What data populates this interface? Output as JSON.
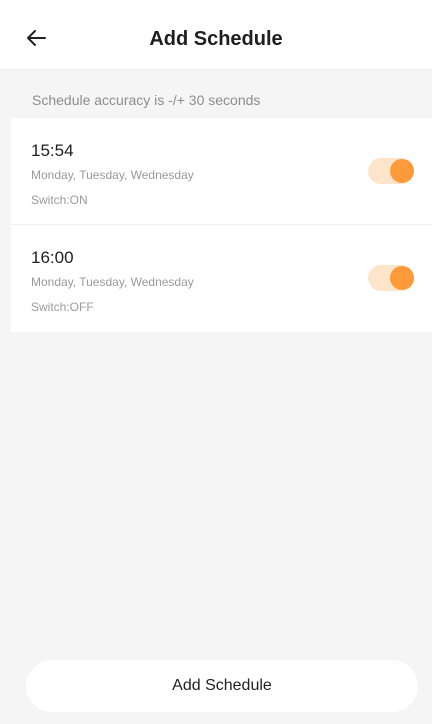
{
  "header": {
    "title": "Add Schedule",
    "back_icon": "arrow-left-icon"
  },
  "accuracy_note": "Schedule accuracy is -/+ 30 seconds",
  "schedules": [
    {
      "time": "15:54",
      "days": "Monday, Tuesday, Wednesday",
      "switch": "Switch:ON",
      "enabled": true
    },
    {
      "time": "16:00",
      "days": "Monday, Tuesday, Wednesday",
      "switch": "Switch:OFF",
      "enabled": true
    }
  ],
  "add_button_label": "Add Schedule",
  "colors": {
    "accent": "#ff9a3a",
    "accent_track": "#fde5cc",
    "background": "#f5f5f6",
    "muted_text": "#9a9a9a"
  }
}
